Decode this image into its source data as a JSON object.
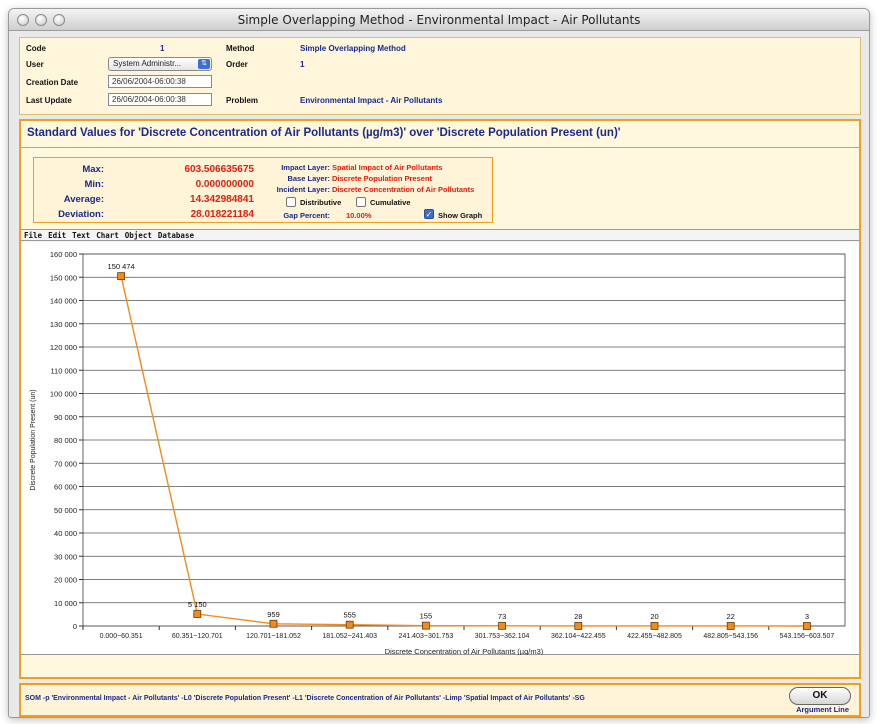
{
  "window": {
    "title": "Simple Overlapping Method - Environmental Impact - Air Pollutants"
  },
  "info": {
    "code_label": "Code",
    "code_value": "1",
    "user_label": "User",
    "user_value": "System Administr...",
    "creation_label": "Creation Date",
    "creation_value": "26/06/2004-06:00:38",
    "update_label": "Last Update",
    "update_value": "26/06/2004-06:00:38",
    "method_label": "Method",
    "method_value": "Simple Overlapping Method",
    "order_label": "Order",
    "order_value": "1",
    "problem_label": "Problem",
    "problem_value": "Environmental Impact - Air Pollutants"
  },
  "panel": {
    "title": "Standard Values for 'Discrete Concentration of Air Pollutants (µg/m3)' over 'Discrete Population Present (un)'"
  },
  "stats": {
    "max_label": "Max:",
    "max_value": "603.506635675",
    "min_label": "Min:",
    "min_value": "0.000000000",
    "avg_label": "Average:",
    "avg_value": "14.342984841",
    "dev_label": "Deviation:",
    "dev_value": "28.018221184"
  },
  "layers": {
    "impact_label": "Impact Layer:",
    "impact_value": "Spatial Impact of Air Pollutants",
    "base_label": "Base Layer:",
    "base_value": "Discrete Population Present",
    "incident_label": "Incident Layer:",
    "incident_value": "Discrete Concentration of Air Pollutants",
    "distributive_label": "Distributive",
    "cumulative_label": "Cumulative",
    "gap_label": "Gap Percent:",
    "gap_value": "10.00%",
    "show_graph_label": "Show Graph"
  },
  "menu": {
    "items": [
      "File",
      "Edit",
      "Text",
      "Chart",
      "Object",
      "Database"
    ]
  },
  "chart_data": {
    "type": "line",
    "xlabel": "Discrete Concentration of Air Pollutants (µg/m3)",
    "ylabel": "Discrete Population Present (un)",
    "categories": [
      "0.000~60.351",
      "60.351~120.701",
      "120.701~181.052",
      "181.052~241.403",
      "241.403~301.753",
      "301.753~362.104",
      "362.104~422.455",
      "422.455~482.805",
      "482.805~543.156",
      "543.156~603.507"
    ],
    "values": [
      150474,
      5150,
      959,
      555,
      155,
      73,
      28,
      20,
      22,
      3
    ],
    "data_labels": [
      "150 474",
      "5 150",
      "959",
      "555",
      "155",
      "73",
      "28",
      "20",
      "22",
      "3"
    ],
    "yticks": [
      "0",
      "10 000",
      "20 000",
      "30 000",
      "40 000",
      "50 000",
      "60 000",
      "70 000",
      "80 000",
      "90 000",
      "100 000",
      "110 000",
      "120 000",
      "130 000",
      "140 000",
      "150 000",
      "160 000"
    ],
    "ylim": [
      0,
      160000
    ],
    "grid": true,
    "color": "#f08c1c"
  },
  "bottom": {
    "argument": "SOM -p 'Environmental Impact - Air Pollutants' -L0 'Discrete Population Present' -L1 'Discrete Concentration of Air Pollutants' -Limp 'Spatial Impact of Air Pollutants' -SG",
    "ok_label": "OK",
    "arg_label": "Argument Line"
  }
}
